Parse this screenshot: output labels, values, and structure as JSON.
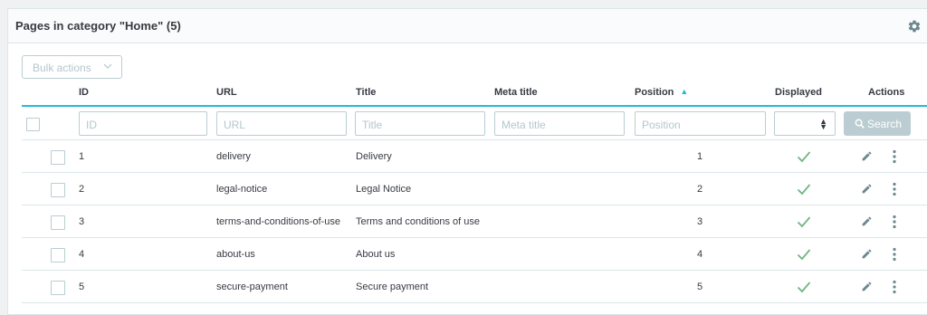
{
  "card": {
    "title": "Pages in category \"Home\" (5)"
  },
  "bulk": {
    "label": "Bulk actions"
  },
  "columns": {
    "id": "ID",
    "url": "URL",
    "title": "Title",
    "meta_title": "Meta title",
    "position": "Position",
    "displayed": "Displayed",
    "actions": "Actions"
  },
  "filters": {
    "id_placeholder": "ID",
    "url_placeholder": "URL",
    "title_placeholder": "Title",
    "meta_title_placeholder": "Meta title",
    "position_placeholder": "Position",
    "search_label": "Search"
  },
  "rows": [
    {
      "id": "1",
      "url": "delivery",
      "title": "Delivery",
      "meta_title": "",
      "position": "1",
      "displayed": true
    },
    {
      "id": "2",
      "url": "legal-notice",
      "title": "Legal Notice",
      "meta_title": "",
      "position": "2",
      "displayed": true
    },
    {
      "id": "3",
      "url": "terms-and-conditions-of-use",
      "title": "Terms and conditions of use",
      "meta_title": "",
      "position": "3",
      "displayed": true
    },
    {
      "id": "4",
      "url": "about-us",
      "title": "About us",
      "meta_title": "",
      "position": "4",
      "displayed": true
    },
    {
      "id": "5",
      "url": "secure-payment",
      "title": "Secure payment",
      "meta_title": "",
      "position": "5",
      "displayed": true
    }
  ],
  "icons": {
    "settings": "gear-icon",
    "sort": "sort-ascending-icon",
    "search": "search-icon",
    "displayed": "check-icon",
    "edit": "pencil-icon",
    "more": "kebab-menu-icon"
  },
  "colors": {
    "accent": "#25b9d7",
    "success": "#70b580",
    "muted": "#6c868e",
    "border": "#bbcdd2"
  }
}
